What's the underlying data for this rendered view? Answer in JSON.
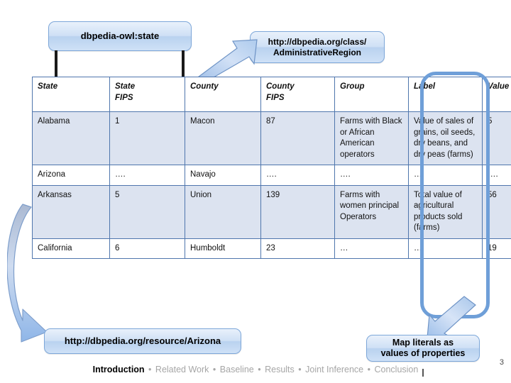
{
  "callouts": {
    "state_property": "dbpedia-owl:state",
    "class_uri_line1": "http://dbpedia.org/class/",
    "class_uri_line2": "AdministrativeRegion",
    "resource_uri": "http://dbpedia.org/resource/Arizona",
    "map_literals_line1": "Map literals as",
    "map_literals_line2": "values of properties"
  },
  "table": {
    "headers": [
      {
        "line1": "State",
        "line2": ""
      },
      {
        "line1": "State",
        "line2": "FIPS"
      },
      {
        "line1": "County",
        "line2": ""
      },
      {
        "line1": "County",
        "line2": "FIPS"
      },
      {
        "line1": "Group",
        "line2": ""
      },
      {
        "line1": "Label",
        "line2": ""
      },
      {
        "line1": "Value",
        "line2": ""
      }
    ],
    "rows": [
      {
        "shaded": true,
        "state": "Alabama",
        "state_fips": "1",
        "county": "Macon",
        "county_fips": "87",
        "group": "Farms with Black or African American operators",
        "label": "Value of sales of grains, oil seeds, dry beans, and dry peas (farms)",
        "value": "5"
      },
      {
        "shaded": false,
        "state": "Arizona",
        "state_fips": "….",
        "county": "Navajo",
        "county_fips": "….",
        "group": "….",
        "label": "….",
        "value": "…."
      },
      {
        "shaded": true,
        "state": "Arkansas",
        "state_fips": "5",
        "county": "Union",
        "county_fips": "139",
        "group": "Farms with women principal Operators",
        "label": "Total value of agricultural products sold (farms)",
        "value": "56"
      },
      {
        "shaded": false,
        "state": "California",
        "state_fips": "6",
        "county": "Humboldt",
        "county_fips": "23",
        "group": "…",
        "label": "….",
        "value": "19"
      }
    ]
  },
  "nav": {
    "items": [
      {
        "label": "Introduction",
        "active": true
      },
      {
        "label": "Related Work",
        "active": false
      },
      {
        "label": "Baseline",
        "active": false
      },
      {
        "label": "Results",
        "active": false
      },
      {
        "label": "Joint Inference",
        "active": false
      },
      {
        "label": "Conclusion",
        "active": false
      }
    ],
    "separator": "•",
    "page_number": "3"
  },
  "colors": {
    "callout_border": "#7da7d9",
    "callout_fill": "#cfe0f5",
    "table_border": "#4f76ad",
    "row_shade": "#dce3f0",
    "highlight_ring": "#6f9fd8",
    "arrow_fill": "#b8cdec",
    "nav_active": "#000000",
    "nav_inactive": "#a6a6a6"
  }
}
